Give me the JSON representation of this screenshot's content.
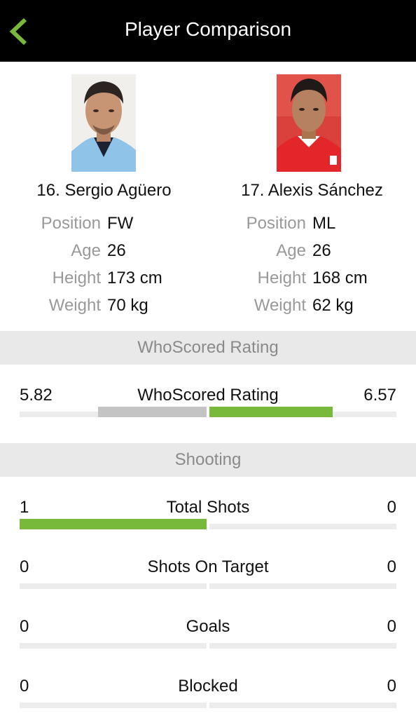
{
  "header": {
    "title": "Player Comparison",
    "back_icon": "chevron-left-icon"
  },
  "players": [
    {
      "name": "16. Sergio Agüero",
      "photo": "player-photo-aguero",
      "stats": [
        {
          "label": "Position",
          "value": "FW"
        },
        {
          "label": "Age",
          "value": "26"
        },
        {
          "label": "Height",
          "value": "173 cm"
        },
        {
          "label": "Weight",
          "value": "70 kg"
        }
      ]
    },
    {
      "name": "17. Alexis Sánchez",
      "photo": "player-photo-sanchez",
      "stats": [
        {
          "label": "Position",
          "value": "ML"
        },
        {
          "label": "Age",
          "value": "26"
        },
        {
          "label": "Height",
          "value": "168 cm"
        },
        {
          "label": "Weight",
          "value": "62 kg"
        }
      ]
    }
  ],
  "rating_section": {
    "title": "WhoScored Rating",
    "metric": {
      "name": "WhoScored Rating",
      "left": "5.82",
      "right": "6.57",
      "left_fraction": 0.58,
      "right_fraction": 0.66
    }
  },
  "shooting_section": {
    "title": "Shooting",
    "metrics": [
      {
        "name": "Total Shots",
        "left": "1",
        "right": "0",
        "left_fraction": 1.0,
        "right_fraction": 0
      },
      {
        "name": "Shots On Target",
        "left": "0",
        "right": "0",
        "left_fraction": 0,
        "right_fraction": 0
      },
      {
        "name": "Goals",
        "left": "0",
        "right": "0",
        "left_fraction": 0,
        "right_fraction": 0
      },
      {
        "name": "Blocked",
        "left": "0",
        "right": "0",
        "left_fraction": 0,
        "right_fraction": 0
      }
    ]
  },
  "colors": {
    "accent": "#78b83a",
    "neutral_bar": "#c4c4c4",
    "header_bg": "#000000"
  }
}
